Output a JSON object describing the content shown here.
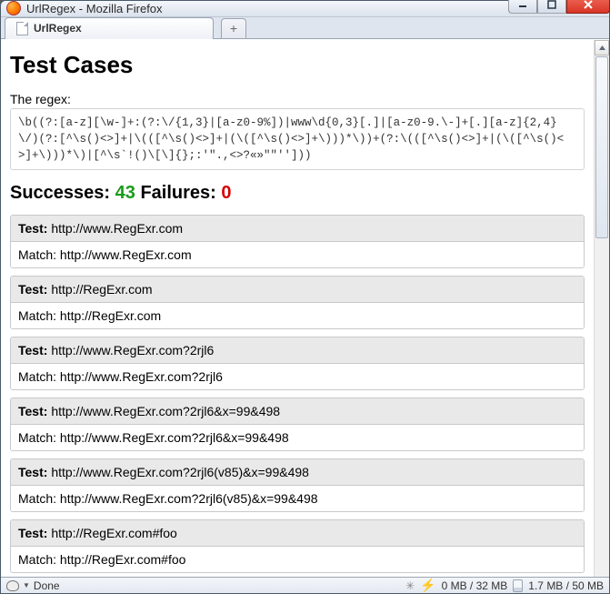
{
  "window": {
    "title": "UrlRegex - Mozilla Firefox"
  },
  "tabs": {
    "active_label": "UrlRegex"
  },
  "page": {
    "heading": "Test Cases",
    "regex_label": "The regex:",
    "regex_text": "\\b((?:[a-z][\\w-]+:(?:\\/{1,3}|[a-z0-9%])|www\\d{0,3}[.]|[a-z0-9.\\-]+[.][a-z]{2,4}\\/)(?:[^\\s()<>]+|\\(([^\\s()<>]+|(\\([^\\s()<>]+\\)))*\\))+(?:\\(([^\\s()<>]+|(\\([^\\s()<>]+\\)))*\\)|[^\\s`!()\\[\\]{};:'\".,<>?«»\"\"'']))",
    "summary": {
      "succ_label": "Successes:",
      "succ_count": "43",
      "fail_label": "Failures:",
      "fail_count": "0"
    },
    "test_label": "Test:",
    "match_label": "Match:",
    "cases": [
      {
        "test": "http://www.RegExr.com",
        "match": "http://www.RegExr.com"
      },
      {
        "test": "http://RegExr.com",
        "match": "http://RegExr.com"
      },
      {
        "test": "http://www.RegExr.com?2rjl6",
        "match": "http://www.RegExr.com?2rjl6"
      },
      {
        "test": "http://www.RegExr.com?2rjl6&x=99&498",
        "match": "http://www.RegExr.com?2rjl6&x=99&498"
      },
      {
        "test": "http://www.RegExr.com?2rjl6(v85)&x=99&498",
        "match": "http://www.RegExr.com?2rjl6(v85)&x=99&498"
      },
      {
        "test": "http://RegExr.com#foo",
        "match": "http://RegExr.com#foo"
      }
    ]
  },
  "status": {
    "message": "Done",
    "mem_js": "0 MB / 32 MB",
    "mem_total": "1.7 MB / 50 MB"
  }
}
